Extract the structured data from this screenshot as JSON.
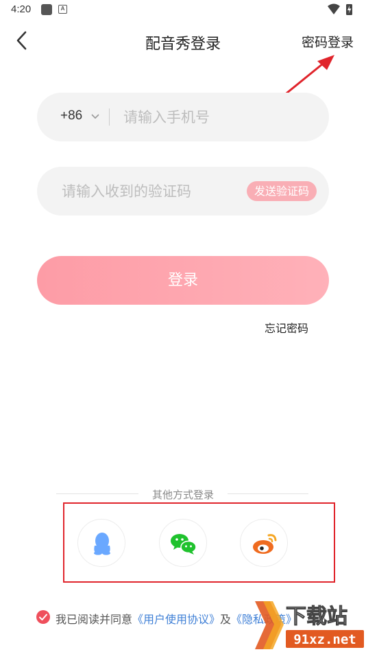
{
  "status_bar": {
    "time": "4:20",
    "notification_icons": [
      "app-square-icon",
      "a-badge-icon"
    ],
    "system_icons": [
      "wifi-icon",
      "battery-charging-icon"
    ]
  },
  "nav": {
    "title": "配音秀登录",
    "back_icon": "chevron-left-icon",
    "password_login_label": "密码登录"
  },
  "annotation": {
    "arrow_color": "#e0242b",
    "box_color": "#e0242b"
  },
  "form": {
    "country_code": "+86",
    "phone_placeholder": "请输入手机号",
    "code_placeholder": "请输入收到的验证码",
    "send_code_label": "发送验证码",
    "login_label": "登录",
    "forgot_label": "忘记密码"
  },
  "other_login": {
    "label": "其他方式登录",
    "methods": [
      {
        "icon": "qq-icon",
        "color": "#6aa8ff"
      },
      {
        "icon": "wechat-icon",
        "color": "#1fc22d"
      },
      {
        "icon": "weibo-icon",
        "color": "#ef6b1f"
      }
    ]
  },
  "agreement": {
    "text": "我已阅读并同意",
    "user_agreement": "《用户使用协议》",
    "and": "及",
    "privacy_policy": "《隐私政策》",
    "checked": true,
    "check_color": "#ef4f5c",
    "link_color": "#3e7fd6"
  },
  "watermark": {
    "text_top": "下载站",
    "text_bottom": "91xz.net"
  },
  "colors": {
    "accent": "#fd9ca6",
    "field_bg": "#f3f3f3",
    "send_code_bg": "#f9aeb5"
  }
}
